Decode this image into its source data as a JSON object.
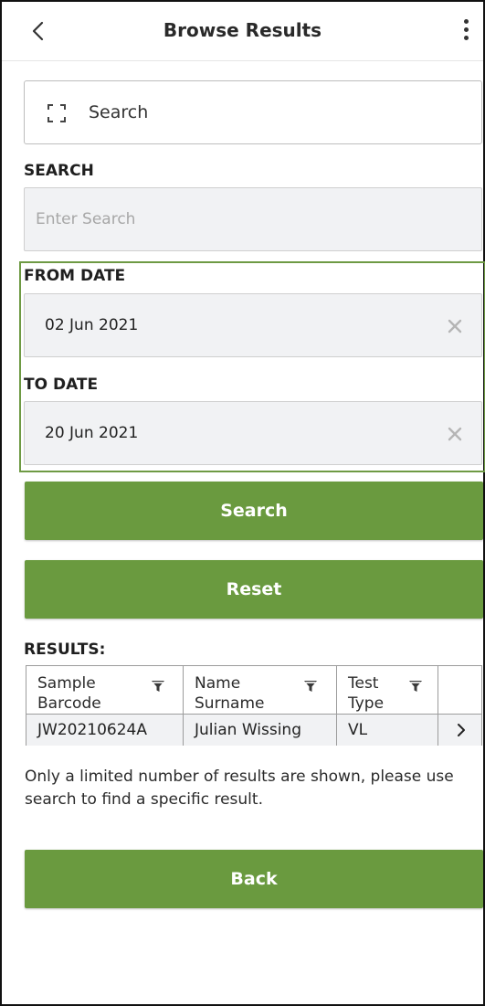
{
  "header": {
    "title": "Browse Results"
  },
  "quick_search": {
    "placeholder": "Search"
  },
  "search": {
    "label": "SEARCH",
    "placeholder": "Enter Search"
  },
  "from_date": {
    "label": "FROM DATE",
    "value": "02 Jun 2021"
  },
  "to_date": {
    "label": "TO DATE",
    "value": "20 Jun 2021"
  },
  "buttons": {
    "search": "Search",
    "reset": "Reset",
    "back": "Back"
  },
  "results": {
    "label": "RESULTS:",
    "columns": [
      {
        "line1": "Sample",
        "line2": "Barcode"
      },
      {
        "line1": "Name",
        "line2": "Surname"
      },
      {
        "line1": "Test",
        "line2": "Type"
      }
    ],
    "rows": [
      {
        "barcode": "JW20210624A",
        "name": "Julian Wissing",
        "type": "VL"
      }
    ]
  },
  "notice": "Only a limited number of results are shown, please use search to find a specific result.",
  "colors": {
    "primary": "#6a9a3f",
    "highlight_border": "#6e9a44",
    "field_bg": "#f1f2f4"
  },
  "icons": {
    "back": "chevron-left-icon",
    "menu": "kebab-menu-icon",
    "scan": "scan-icon",
    "clear": "close-icon",
    "filter": "filter-icon",
    "row": "chevron-right-icon"
  }
}
